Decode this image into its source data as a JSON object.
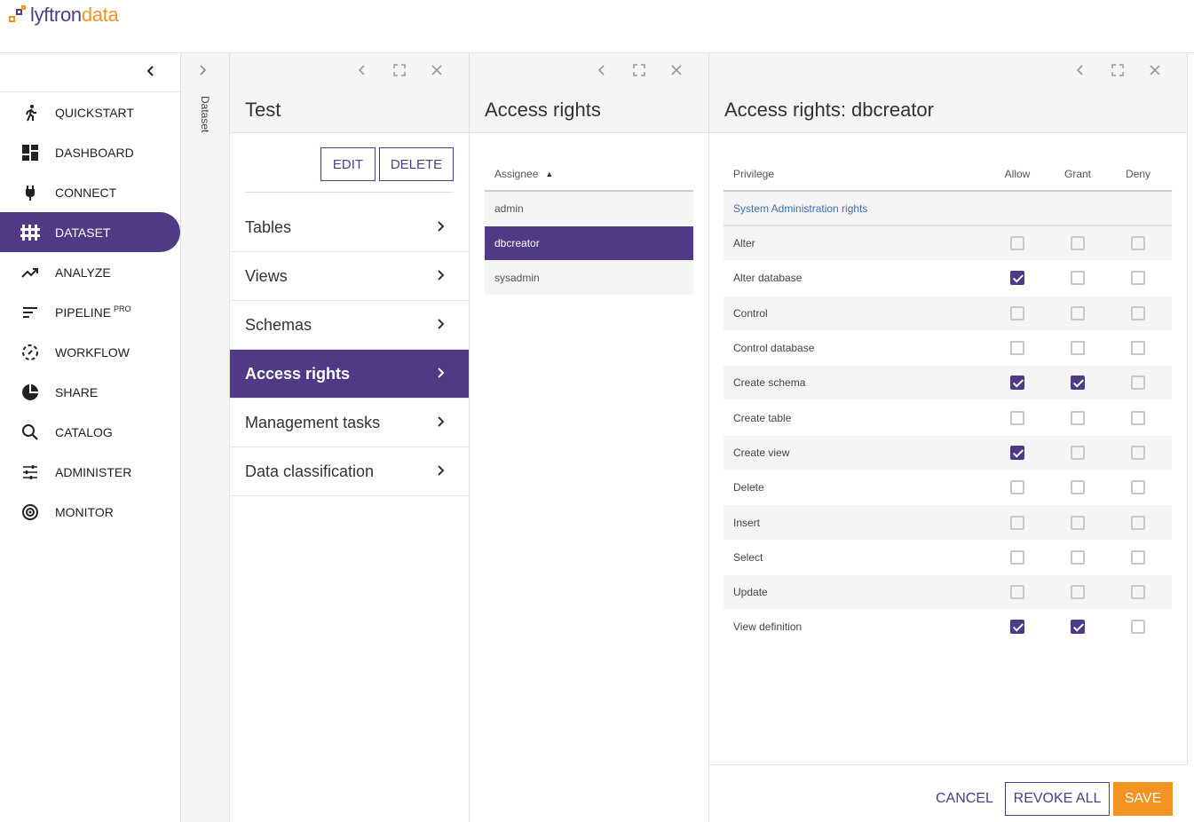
{
  "brand": {
    "logo_part1": "lyftron",
    "logo_part2": "data",
    "orange": "#f39321",
    "purple": "#503a86"
  },
  "sidebar": {
    "collapse_icon": "chevron-left-icon",
    "items": [
      {
        "label": "QUICKSTART",
        "icon": "run-icon"
      },
      {
        "label": "DASHBOARD",
        "icon": "dashboard-icon"
      },
      {
        "label": "CONNECT",
        "icon": "plug-icon"
      },
      {
        "label": "DATASET",
        "icon": "dataset-icon",
        "active": true
      },
      {
        "label": "ANALYZE",
        "icon": "trending-icon"
      },
      {
        "label": "PIPELINE",
        "badge": "PRO",
        "icon": "pipeline-icon"
      },
      {
        "label": "WORKFLOW",
        "icon": "workflow-icon"
      },
      {
        "label": "SHARE",
        "icon": "pie-icon"
      },
      {
        "label": "CATALOG",
        "icon": "search-icon"
      },
      {
        "label": "ADMINISTER",
        "icon": "sliders-icon"
      },
      {
        "label": "MONITOR",
        "icon": "monitor-icon"
      }
    ]
  },
  "strip": {
    "label": "Dataset"
  },
  "panel1": {
    "title": "Test",
    "edit_label": "EDIT",
    "delete_label": "DELETE",
    "menu": [
      "Tables",
      "Views",
      "Schemas",
      "Access rights",
      "Management tasks",
      "Data classification"
    ],
    "active_menu": "Access rights"
  },
  "panel2": {
    "title": "Access rights",
    "column": "Assignee",
    "rows": [
      "admin",
      "dbcreator",
      "sysadmin"
    ],
    "selected": "dbcreator"
  },
  "panel3": {
    "title": "Access rights: dbcreator",
    "columns": {
      "privilege": "Privilege",
      "allow": "Allow",
      "grant": "Grant",
      "deny": "Deny"
    },
    "group": "System Administration rights",
    "rows": [
      {
        "name": "Alter",
        "allow": false,
        "grant": false,
        "deny": false
      },
      {
        "name": "Alter database",
        "allow": true,
        "grant": false,
        "deny": false
      },
      {
        "name": "Control",
        "allow": false,
        "grant": false,
        "deny": false
      },
      {
        "name": "Control database",
        "allow": false,
        "grant": false,
        "deny": false
      },
      {
        "name": "Create schema",
        "allow": true,
        "grant": true,
        "deny": false
      },
      {
        "name": "Create table",
        "allow": false,
        "grant": false,
        "deny": false
      },
      {
        "name": "Create view",
        "allow": true,
        "grant": false,
        "deny": false
      },
      {
        "name": "Delete",
        "allow": false,
        "grant": false,
        "deny": false
      },
      {
        "name": "Insert",
        "allow": false,
        "grant": false,
        "deny": false
      },
      {
        "name": "Select",
        "allow": false,
        "grant": false,
        "deny": false
      },
      {
        "name": "Update",
        "allow": false,
        "grant": false,
        "deny": false
      },
      {
        "name": "View definition",
        "allow": true,
        "grant": true,
        "deny": false
      }
    ],
    "cancel_label": "CANCEL",
    "revoke_label": "REVOKE ALL",
    "save_label": "SAVE"
  }
}
